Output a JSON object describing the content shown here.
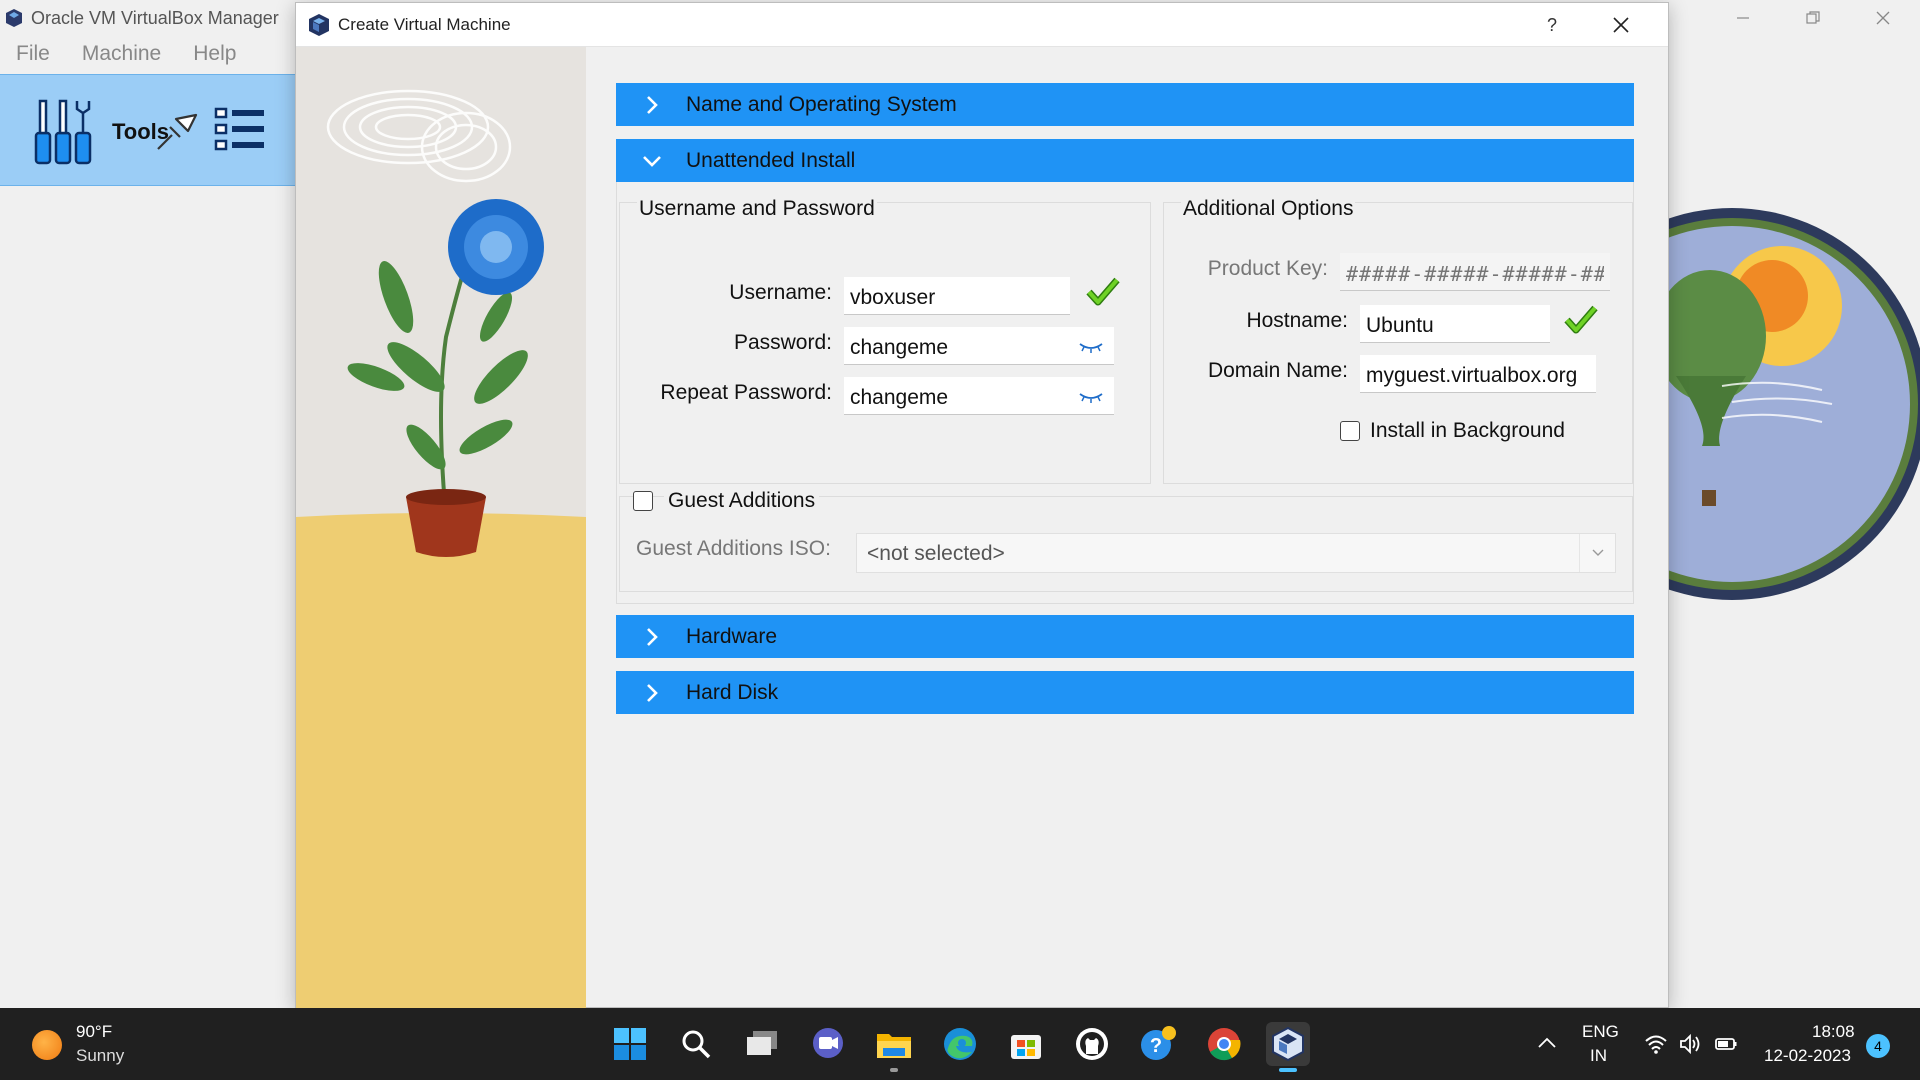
{
  "manager": {
    "title": "Oracle VM VirtualBox Manager",
    "menu": [
      "File",
      "Machine",
      "Help"
    ],
    "tools_label": "Tools"
  },
  "dialog": {
    "title": "Create Virtual Machine",
    "help_label": "?",
    "sections": {
      "name_os": "Name and Operating System",
      "unattended": "Unattended Install",
      "hardware": "Hardware",
      "hard_disk": "Hard Disk"
    },
    "unattended_install": {
      "credentials_group": "Username and Password",
      "username_label": "Username:",
      "username_value": "vboxuser",
      "password_label": "Password:",
      "password_value": "changeme",
      "repeat_password_label": "Repeat Password:",
      "repeat_password_value": "changeme",
      "additional_group": "Additional Options",
      "product_key_label": "Product Key:",
      "product_key_placeholder": "#####-#####-#####-#####-#####",
      "hostname_label": "Hostname:",
      "hostname_value": "Ubuntu",
      "domain_label": "Domain Name:",
      "domain_value": "myguest.virtualbox.org",
      "install_background_label": "Install in Background",
      "install_background_checked": false,
      "guest_additions_label": "Guest Additions",
      "guest_additions_checked": false,
      "guest_additions_iso_label": "Guest Additions ISO:",
      "guest_additions_iso_value": "<not selected>"
    }
  },
  "taskbar": {
    "weather_temp": "90°F",
    "weather_desc": "Sunny",
    "apps": [
      "start-icon",
      "search-icon",
      "task-view-icon",
      "teams-chat-icon",
      "file-explorer-icon",
      "edge-icon",
      "microsoft-store-icon",
      "github-icon",
      "get-help-icon",
      "chrome-icon",
      "virtualbox-icon"
    ],
    "lang_line1": "ENG",
    "lang_line2": "IN",
    "time": "18:08",
    "date": "12-02-2023",
    "notification_count": "4"
  },
  "colors": {
    "section_header": "#1f93f5",
    "tools_panel": "#9bcdf6",
    "taskbar": "#202020",
    "valid_check": "#4caf1a"
  }
}
